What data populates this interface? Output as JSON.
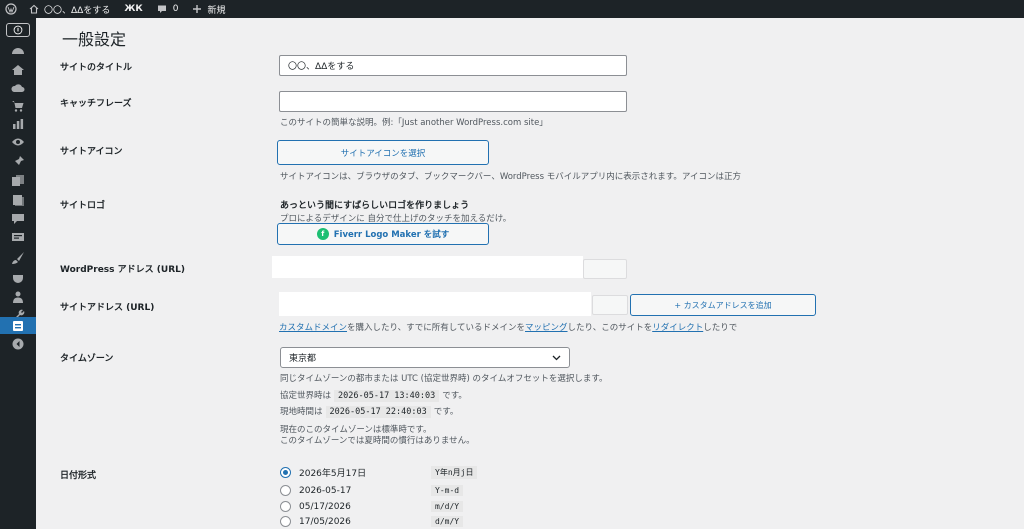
{
  "admin_bar": {
    "site_name": "〇〇、ΔΔをする",
    "stats_label": "ЖК",
    "comments_count": "0",
    "new_label": "新規"
  },
  "page": {
    "title": "一般設定"
  },
  "settings": {
    "site_title": {
      "label": "サイトのタイトル",
      "value": "〇〇、ΔΔをする"
    },
    "tagline": {
      "label": "キャッチフレーズ",
      "value": "",
      "description": "このサイトの簡単な説明。例:「Just another WordPress.com site」"
    },
    "site_icon": {
      "label": "サイトアイコン",
      "button": "サイトアイコンを選択",
      "description": "サイトアイコンは、ブラウザのタブ、ブックマークバー、WordPress モバイルアプリ内に表示されます。アイコンは正方"
    },
    "site_logo": {
      "label": "サイトロゴ",
      "heading": "あっという間にすばらしいロゴを作りましょう",
      "description": "プロによるデザインに 自分で仕上げのタッチを加えるだけ。",
      "button": "Fiverr Logo Maker を試す"
    },
    "wp_address": {
      "label": "WordPress アドレス (URL)"
    },
    "site_address": {
      "label": "サイトアドレス (URL)",
      "button": "+ カスタムアドレスを追加",
      "desc_link1": "カスタムドメイン",
      "desc_text1": "を購入したり、すでに所有しているドメインを",
      "desc_link2": "マッピング",
      "desc_text2": "したり、このサイトを",
      "desc_link3": "リダイレクト",
      "desc_text3": "したりで"
    },
    "timezone": {
      "label": "タイムゾーン",
      "value": "東京都",
      "description": "同じタイムゾーンの都市または UTC (協定世界時) のタイムオフセットを選択します。",
      "utc_prefix": "協定世界時は",
      "utc_time": "2026-05-17 13:40:03",
      "utc_suffix": "です。",
      "local_prefix": "現地時間は",
      "local_time": "2026-05-17 22:40:03",
      "local_suffix": "です。",
      "note1": "現在のこのタイムゾーンは標準時です。",
      "note2": "このタイムゾーンでは夏時間の慣行はありません。"
    },
    "date_format": {
      "label": "日付形式",
      "options": [
        {
          "display": "2026年5月17日",
          "format": "Y年n月j日",
          "checked": true
        },
        {
          "display": "2026-05-17",
          "format": "Y-m-d",
          "checked": false
        },
        {
          "display": "05/17/2026",
          "format": "m/d/Y",
          "checked": false
        },
        {
          "display": "17/05/2026",
          "format": "d/m/Y",
          "checked": false
        }
      ]
    }
  },
  "colors": {
    "accent": "#2271b1",
    "admin_bar": "#1d2327"
  }
}
